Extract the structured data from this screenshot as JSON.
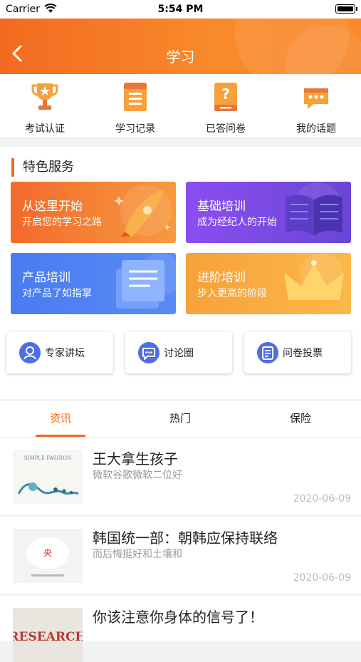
{
  "status_bar": {
    "carrier": "Carrier",
    "time": "5:54 PM"
  },
  "header": {
    "title": "学习"
  },
  "quick_menu": [
    {
      "label": "考试认证",
      "icon": "trophy-icon"
    },
    {
      "label": "学习记录",
      "icon": "list-icon"
    },
    {
      "label": "已答问卷",
      "icon": "question-doc-icon"
    },
    {
      "label": "我的话题",
      "icon": "chat-bubble-icon"
    }
  ],
  "services": {
    "title": "特色服务",
    "cards": [
      {
        "title": "从这里开始",
        "subtitle": "开启您的学习之路",
        "color": "#f26a2c",
        "icon": "rocket-icon"
      },
      {
        "title": "基础培训",
        "subtitle": "成为经纪人的开始",
        "color": "#7a4ee6",
        "icon": "open-book-icon"
      },
      {
        "title": "产品培训",
        "subtitle": "对产品了如指掌",
        "color": "#4a7cf0",
        "icon": "document-icon"
      },
      {
        "title": "进阶培训",
        "subtitle": "步入更高的阶段",
        "color": "#f9a83a",
        "icon": "crown-icon"
      }
    ],
    "pills": [
      {
        "label": "专家讲坛",
        "icon": "person-icon"
      },
      {
        "label": "讨论圈",
        "icon": "chat-icon"
      },
      {
        "label": "问卷投票",
        "icon": "form-icon"
      }
    ]
  },
  "tabs": [
    {
      "label": "资讯",
      "active": true
    },
    {
      "label": "热门",
      "active": false
    },
    {
      "label": "保险",
      "active": false
    }
  ],
  "news": [
    {
      "title": "王大拿生孩子",
      "subtitle": "微软谷歌微软二位好",
      "date": "2020-06-09",
      "thumb_text": "SIMPLE FASHION"
    },
    {
      "title": "韩国统一部：朝韩应保持联络",
      "subtitle": "而后悔挺好和土壤和",
      "date": "2020-06-09",
      "thumb_text": "央"
    },
    {
      "title": "你该注意你身体的信号了！",
      "subtitle": "",
      "date": "",
      "thumb_text": "RESEARCH"
    }
  ]
}
